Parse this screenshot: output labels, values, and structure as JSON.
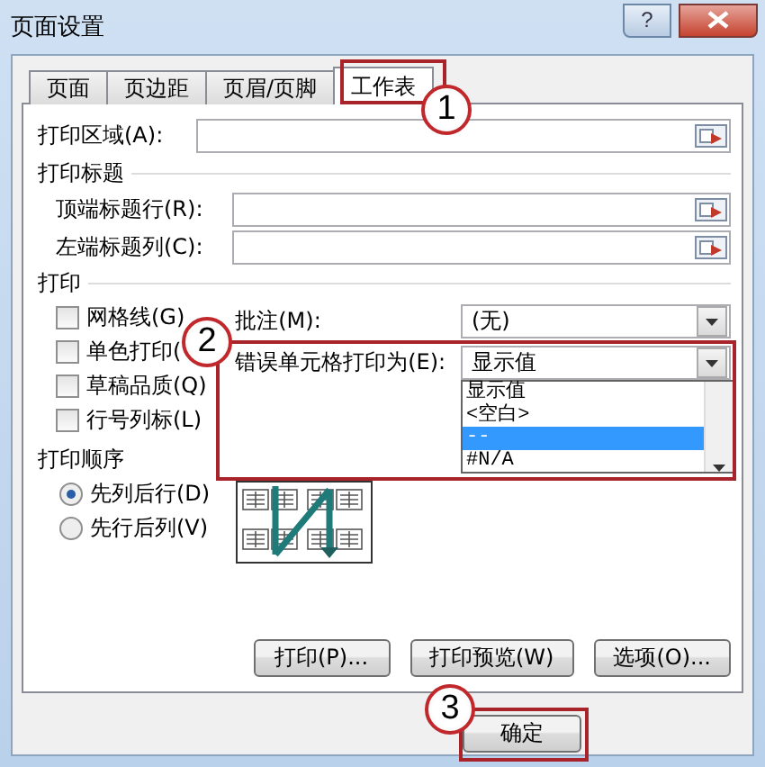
{
  "window": {
    "title": "页面设置",
    "help": "?"
  },
  "tabs": [
    {
      "label": "页面",
      "selected": false
    },
    {
      "label": "页边距",
      "selected": false
    },
    {
      "label": "页眉/页脚",
      "selected": false
    },
    {
      "label": "工作表",
      "selected": true
    }
  ],
  "print_area": {
    "label": "打印区域(A):"
  },
  "print_titles": {
    "heading": "打印标题",
    "fields": [
      {
        "label": "顶端标题行(R):"
      },
      {
        "label": "左端标题列(C):"
      }
    ]
  },
  "print": {
    "heading": "打印",
    "checkboxes": [
      {
        "label": "网格线(G)",
        "checked": false
      },
      {
        "label": "单色打印(",
        "checked": false
      },
      {
        "label": "草稿品质(Q)",
        "checked": false
      },
      {
        "label": "行号列标(L)",
        "checked": false
      }
    ],
    "comments": {
      "label": "批注(M):",
      "value": "(无)"
    },
    "cell_errors": {
      "label": "错误单元格打印为(E):",
      "value": "显示值",
      "expanded": true,
      "options": [
        {
          "label": "显示值",
          "highlighted": false
        },
        {
          "label": "<空白>",
          "highlighted": false
        },
        {
          "label": "--",
          "highlighted": true
        },
        {
          "label": "#N/A",
          "highlighted": false
        }
      ]
    }
  },
  "page_order": {
    "heading": "打印顺序",
    "options": [
      {
        "label": "先列后行(D)",
        "selected": true
      },
      {
        "label": "先行后列(V)",
        "selected": false
      }
    ]
  },
  "buttons": [
    "打印(P)...",
    "打印预览(W)",
    "选项(O)..."
  ],
  "footer": {
    "ok": "确定"
  },
  "annotations": [
    {
      "number": "1"
    },
    {
      "number": "2"
    },
    {
      "number": "3"
    }
  ]
}
